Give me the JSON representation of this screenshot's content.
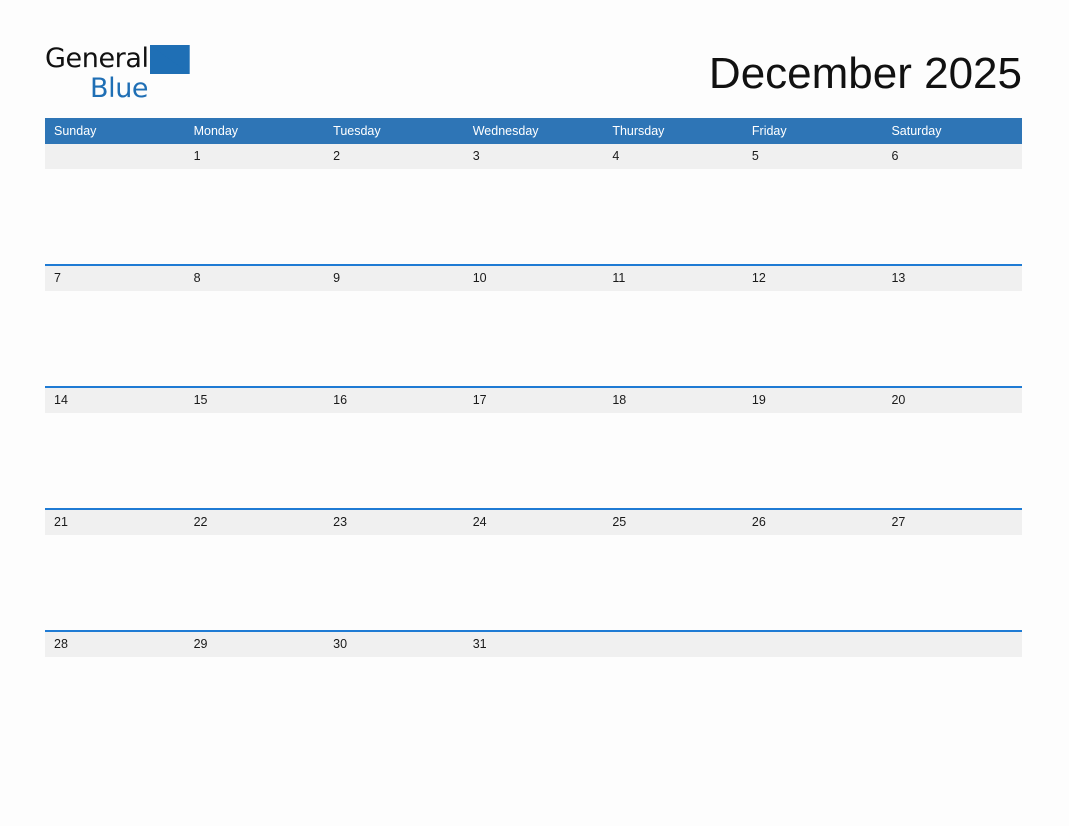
{
  "brand": {
    "name_part1": "General",
    "name_part2": "Blue",
    "triangle_icon": "blue-triangle-icon",
    "primary_color": "#1F6FB5"
  },
  "header": {
    "title": "December 2025"
  },
  "colors": {
    "header_blue": "#2E75B6",
    "rule_blue": "#1F7BD4",
    "date_band_gray": "#F0F0F0",
    "page_background": "#FDFDFD",
    "text_dark": "#111111"
  },
  "calendar": {
    "month": "December",
    "year": "2025",
    "weekday_headers": [
      "Sunday",
      "Monday",
      "Tuesday",
      "Wednesday",
      "Thursday",
      "Friday",
      "Saturday"
    ],
    "weeks": [
      [
        "",
        "1",
        "2",
        "3",
        "4",
        "5",
        "6"
      ],
      [
        "7",
        "8",
        "9",
        "10",
        "11",
        "12",
        "13"
      ],
      [
        "14",
        "15",
        "16",
        "17",
        "18",
        "19",
        "20"
      ],
      [
        "21",
        "22",
        "23",
        "24",
        "25",
        "26",
        "27"
      ],
      [
        "28",
        "29",
        "30",
        "31",
        "",
        "",
        ""
      ]
    ]
  }
}
